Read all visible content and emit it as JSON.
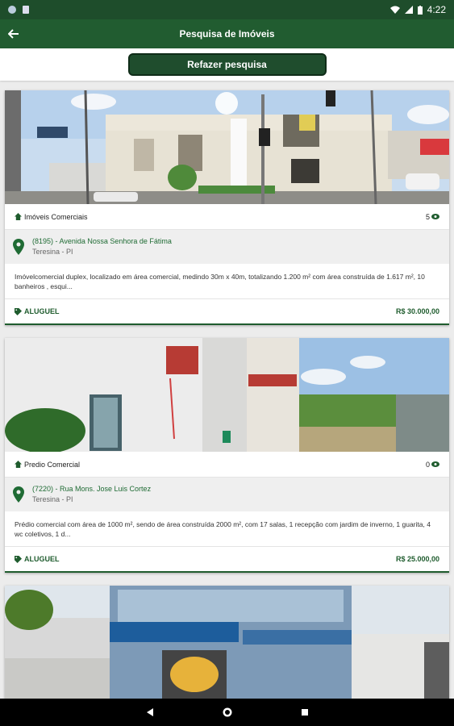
{
  "status_bar": {
    "time": "4:22",
    "wifi_icon": "wifi-icon",
    "signal_icon": "signal-icon",
    "battery_icon": "battery-icon"
  },
  "app_bar": {
    "title": "Pesquisa de Imóveis",
    "back_icon": "arrow-back-icon"
  },
  "toolbar": {
    "redo_search_label": "Refazer pesquisa"
  },
  "listings": [
    {
      "type": "Imóveis Comerciais",
      "views": "5",
      "address_line1": "(8195) - Avenida Nossa Senhora de Fátima",
      "address_line2": "Teresina - PI",
      "description": "Imóvelcomercial duplex,  localizado em área comercial, medindo 30m x 40m, totalizando 1.200 m² com área construída de 1.617  m², 10 banheiros , esqui...",
      "deal": "ALUGUEL",
      "price": "R$ 30.000,00"
    },
    {
      "type": "Predio Comercial",
      "views": "0",
      "address_line1": "(7220) - Rua Mons. Jose Luis Cortez",
      "address_line2": "Teresina - PI",
      "description": "Prédio comercial com área de 1000 m², sendo de área construída 2000 m², com 17 salas, 1 recepção com jardim de inverno, 1 guarita, 4 wc coletivos, 1 d...",
      "deal": "ALUGUEL",
      "price": "R$ 25.000,00"
    }
  ],
  "colors": {
    "brand_dark": "#1e4d2b",
    "brand": "#215c30",
    "accent_text": "#1f6b34"
  }
}
